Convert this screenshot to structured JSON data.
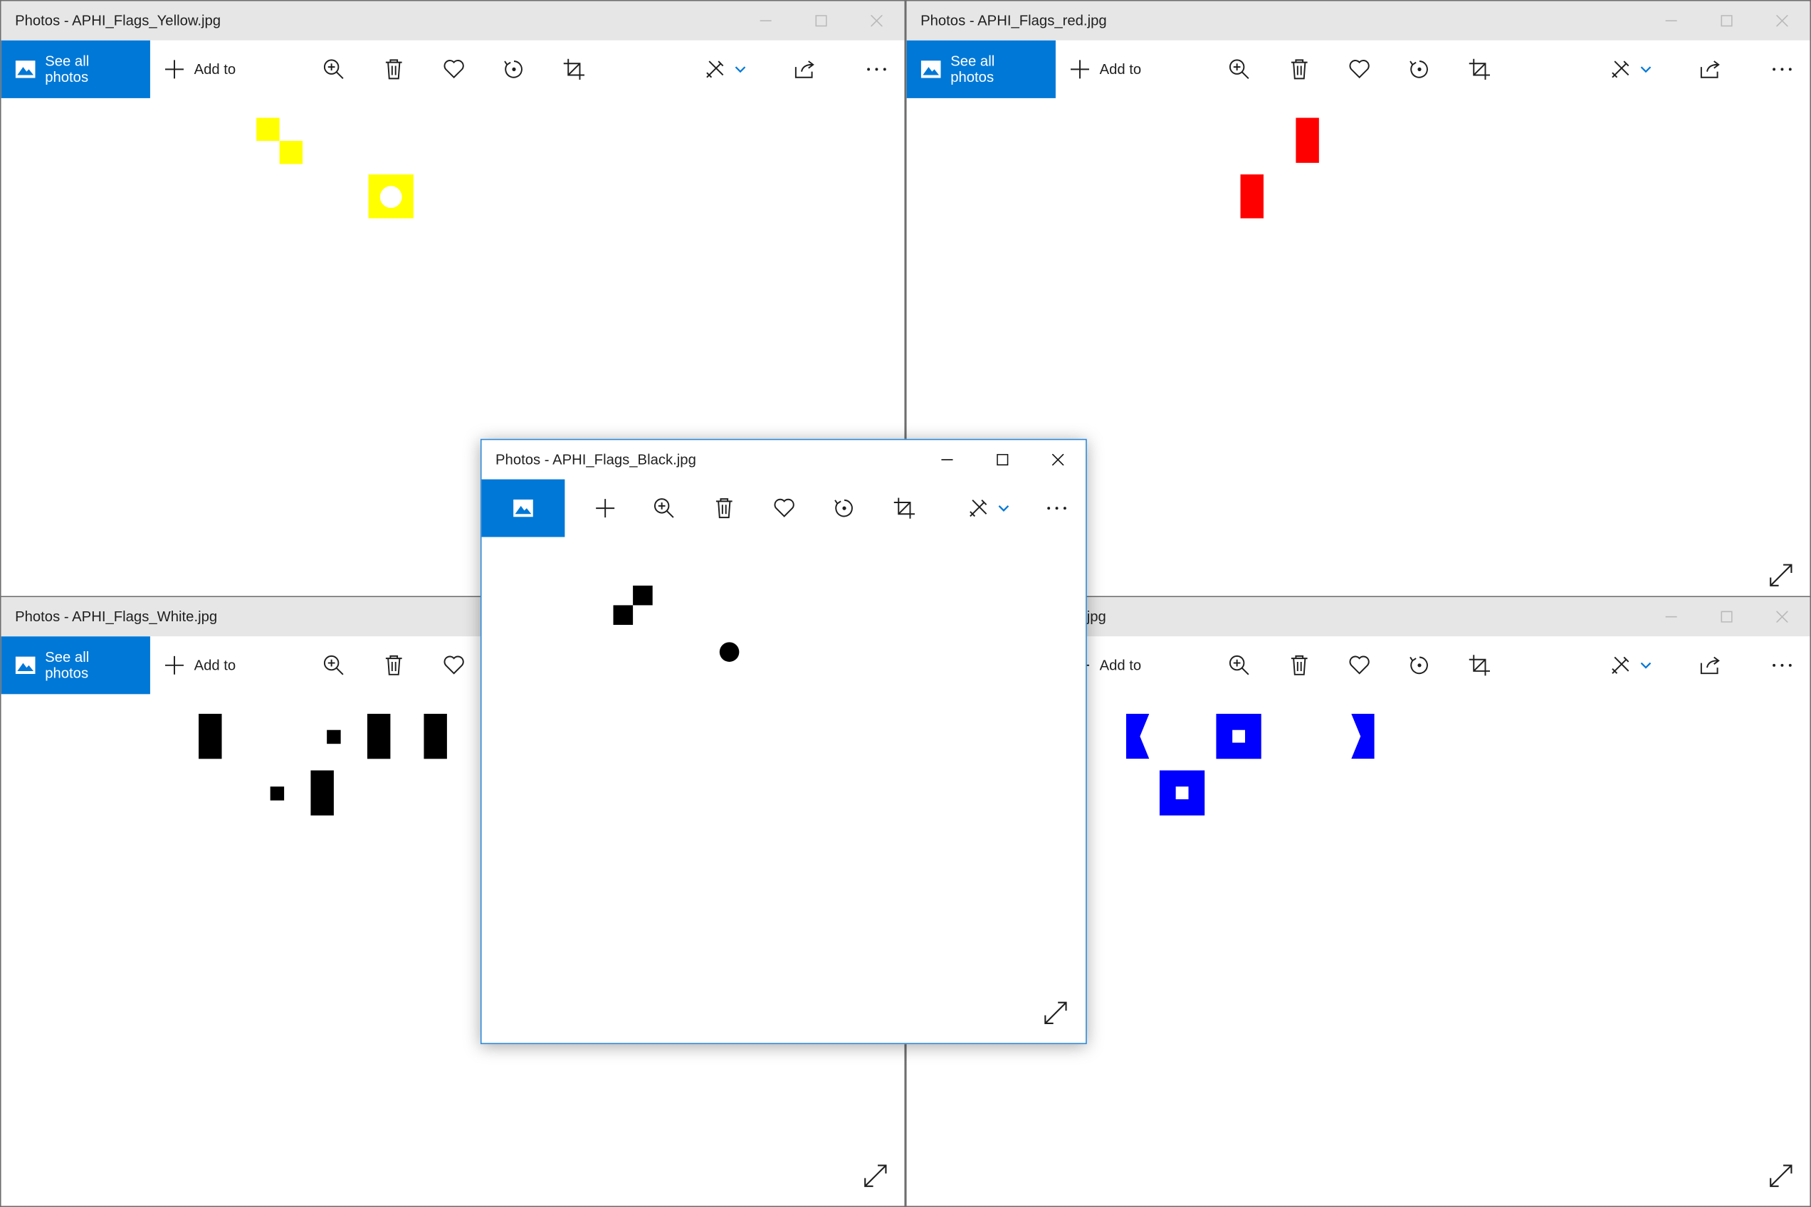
{
  "windows": {
    "yellow": {
      "title": "Photos - APHI_Flags_Yellow.jpg",
      "see_all_label": "See all photos",
      "add_to_label": "Add to",
      "flag_color": "#ffff00"
    },
    "red": {
      "title": "Photos - APHI_Flags_red.jpg",
      "see_all_label": "See all photos",
      "add_to_label": "Add to",
      "flag_color": "#ff0000"
    },
    "white": {
      "title": "Photos - APHI_Flags_White.jpg",
      "see_all_label": "See all photos",
      "add_to_label": "Add to",
      "flag_color": "#000000"
    },
    "blue": {
      "title_visible": "jpg",
      "add_to_label": "Add to",
      "flag_color": "#0000ff"
    },
    "black": {
      "title": "Photos - APHI_Flags_Black.jpg",
      "flag_color": "#000000"
    }
  },
  "toolbar_icons": [
    "zoom-in-icon",
    "delete-icon",
    "favorite-icon",
    "rotate-icon",
    "crop-icon",
    "edit-create-icon",
    "chevron-down-icon",
    "share-icon",
    "more-icon"
  ],
  "colors": {
    "accent": "#0078d7",
    "inactive_titlebar": "#e6e6e6",
    "active_border": "#2b88d8"
  }
}
